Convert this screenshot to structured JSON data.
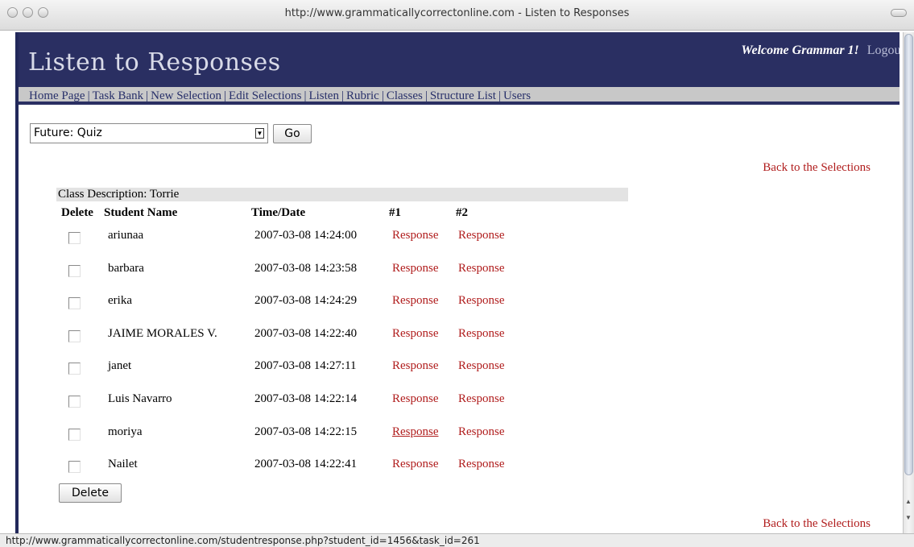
{
  "window": {
    "title": "http://www.grammaticallycorrectonline.com - Listen to Responses"
  },
  "header": {
    "title": "Listen to Responses",
    "welcome": "Welcome Grammar 1!",
    "logout": "Logout"
  },
  "nav": {
    "items": [
      "Home Page",
      "Task Bank",
      "New Selection",
      "Edit Selections",
      "Listen",
      "Rubric",
      "Classes",
      "Structure List",
      "Users"
    ],
    "separator": "|"
  },
  "selection": {
    "selected": "Future: Quiz",
    "go_label": "Go"
  },
  "back_link": "Back to the Selections",
  "table": {
    "class_description": "Class Description: Torrie",
    "headers": {
      "delete": "Delete",
      "student": "Student Name",
      "time": "Time/Date",
      "r1": "#1",
      "r2": "#2"
    },
    "rows": [
      {
        "name": "ariunaa",
        "time": "2007-03-08 14:24:00",
        "r1": "Response",
        "r2": "Response"
      },
      {
        "name": "barbara",
        "time": "2007-03-08 14:23:58",
        "r1": "Response",
        "r2": "Response"
      },
      {
        "name": "erika",
        "time": "2007-03-08 14:24:29",
        "r1": "Response",
        "r2": "Response"
      },
      {
        "name": "JAIME MORALES V.",
        "time": "2007-03-08 14:22:40",
        "r1": "Response",
        "r2": "Response"
      },
      {
        "name": "janet",
        "time": "2007-03-08 14:27:11",
        "r1": "Response",
        "r2": "Response"
      },
      {
        "name": "Luis Navarro",
        "time": "2007-03-08 14:22:14",
        "r1": "Response",
        "r2": "Response"
      },
      {
        "name": "moriya",
        "time": "2007-03-08 14:22:15",
        "r1": "Response",
        "r2": "Response"
      },
      {
        "name": "Nailet",
        "time": "2007-03-08 14:22:41",
        "r1": "Response",
        "r2": "Response"
      }
    ],
    "delete_label": "Delete"
  },
  "status": "http://www.grammaticallycorrectonline.com/studentresponse.php?student_id=1456&task_id=261",
  "colors": {
    "header_bg": "#2a2f62",
    "link_red": "#b01c1c",
    "nav_bg": "#c8c8c8"
  }
}
